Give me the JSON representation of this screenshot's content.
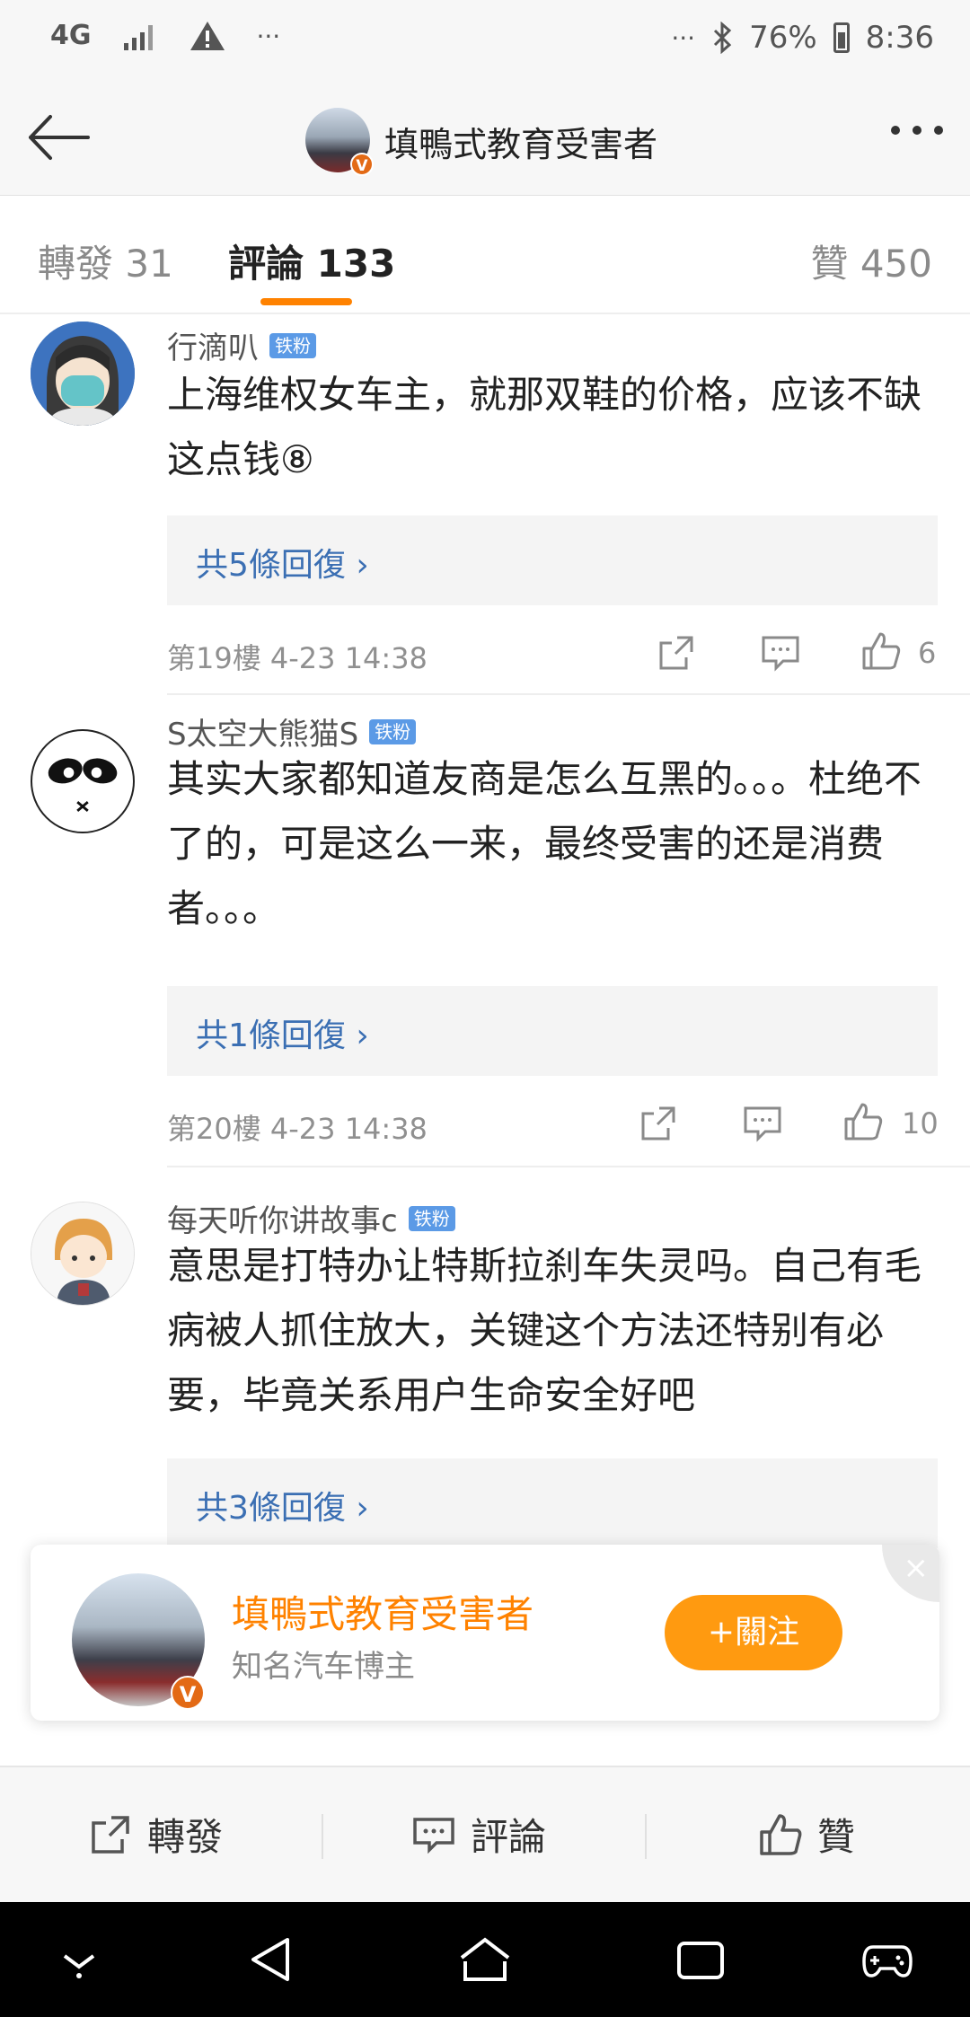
{
  "status_bar": {
    "network": "4G",
    "battery": "76%",
    "time": "8:36"
  },
  "header": {
    "title": "填鴨式教育受害者"
  },
  "tabs": {
    "repost": "轉發 31",
    "comment": "評論 133",
    "like": "贊 450"
  },
  "comments": [
    {
      "username": "行滴叭",
      "badge": "铁粉",
      "text": "上海维权女车主，就那双鞋的价格，应该不缺这点钱⑧",
      "replies": "共5條回復 ›",
      "floor": "第19樓  4-23 14:38",
      "likes": "6"
    },
    {
      "username": "S太空大熊猫S",
      "badge": "铁粉",
      "text": "其实大家都知道友商是怎么互黑的。。。杜绝不了的，可是这么一来，最终受害的还是消费者。。。",
      "replies": "共1條回復 ›",
      "floor": "第20樓  4-23 14:38",
      "likes": "10"
    },
    {
      "username": "每天听你讲故事c",
      "badge": "铁粉",
      "text": "意思是打特办让特斯拉刹车失灵吗。自己有毛病被人抓住放大，关键这个方法还特别有必要，毕竟关系用户生命安全好吧",
      "replies": "共3條回復 ›"
    }
  ],
  "popup": {
    "name": "填鴨式教育受害者",
    "description": "知名汽车博主",
    "follow_label": "+關注",
    "close_label": "×"
  },
  "bottom_bar": {
    "repost": "轉發",
    "comment": "評論",
    "like": "贊"
  },
  "colors": {
    "accent": "#ff8200",
    "link": "#3b6fb3",
    "badge": "#5b9ae6"
  }
}
